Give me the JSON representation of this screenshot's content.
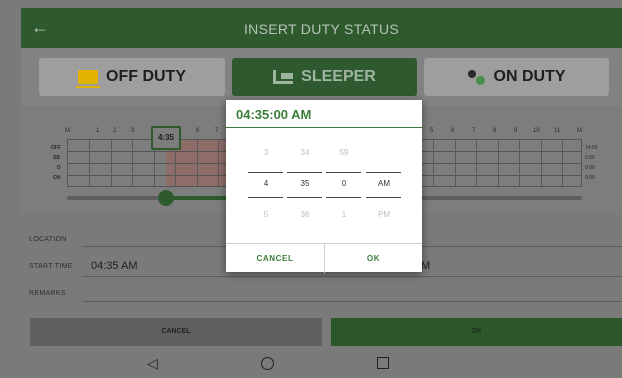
{
  "appbar": {
    "title": "INSERT DUTY STATUS",
    "back_icon": "arrow-left-icon"
  },
  "status_buttons": {
    "off": {
      "label": "OFF DUTY",
      "icon": "coffee-cup-icon"
    },
    "sleeper": {
      "label": "SLEEPER",
      "icon": "bed-icon"
    },
    "on": {
      "label": "ON DUTY",
      "icon": "person-clock-icon"
    }
  },
  "graph": {
    "hour_labels_left": [
      "M",
      "1",
      "2",
      "3"
    ],
    "hour_labels_mid": [
      "6",
      "7"
    ],
    "hour_labels_right": [
      "5",
      "6",
      "7",
      "8",
      "9",
      "10",
      "11",
      "M"
    ],
    "rows": [
      "OFF",
      "SB",
      "D",
      "ON"
    ],
    "totals": [
      "14:59",
      "0:00",
      "0:00",
      "0:00"
    ],
    "bubble_time": "4:35"
  },
  "form": {
    "location_label": "LOCATION",
    "start_time_label": "START TIME",
    "start_time_value": "04:35 AM",
    "end_time_suffix": "M",
    "remarks_label": "REMARKS"
  },
  "bottom": {
    "cancel_label": "CANCEL",
    "ok_label": "OK"
  },
  "dialog": {
    "title": "04:35:00 AM",
    "hour": {
      "prev": "3",
      "value": "4",
      "next": "5"
    },
    "minute": {
      "prev": "34",
      "value": "35",
      "next": "36"
    },
    "second": {
      "prev": "59",
      "value": "0",
      "next": "1"
    },
    "ampm": {
      "prev": "",
      "value": "AM",
      "next": "PM"
    },
    "cancel_label": "CANCEL",
    "ok_label": "OK"
  },
  "colors": {
    "primary": "#2e5a2e",
    "accent": "#3b7d3b",
    "sleeper_shade": "#8e6c67"
  }
}
